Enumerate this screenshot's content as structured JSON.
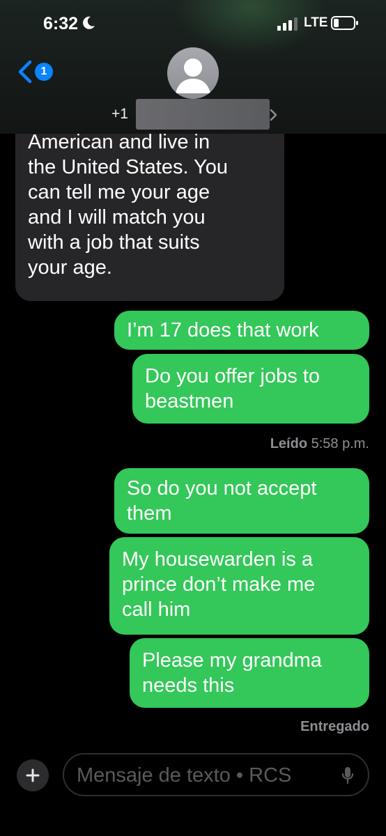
{
  "status_bar": {
    "time": "6:32",
    "network": "LTE"
  },
  "header": {
    "unread_count": "1",
    "contact_prefix": "+1"
  },
  "messages": [
    {
      "direction": "incoming",
      "text": "American and live in\nthe United States. You\ncan tell me your age\nand I will match you\nwith a job that suits\nyour age."
    },
    {
      "direction": "outgoing",
      "text": "I’m 17 does that work"
    },
    {
      "direction": "outgoing",
      "text": "Do you offer jobs to\nbeastmen"
    },
    {
      "direction": "outgoing",
      "text": "So do you not accept\nthem"
    },
    {
      "direction": "outgoing",
      "text": "My housewarden is a\nprince don’t make me\ncall him"
    },
    {
      "direction": "outgoing",
      "text": "Please my grandma\nneeds this"
    }
  ],
  "receipts": {
    "read_label": "Leído",
    "read_time": "5:58 p.m.",
    "delivered_label": "Entregado"
  },
  "composer": {
    "placeholder": "Mensaje de texto • RCS"
  },
  "colors": {
    "outgoing_bubble": "#34c759",
    "incoming_bubble": "#262628",
    "accent": "#0a84ff"
  },
  "icons": [
    "moon-icon",
    "signal-icon",
    "battery-icon",
    "back-chevron-icon",
    "avatar-icon",
    "chevron-right-icon",
    "plus-icon",
    "microphone-icon"
  ]
}
